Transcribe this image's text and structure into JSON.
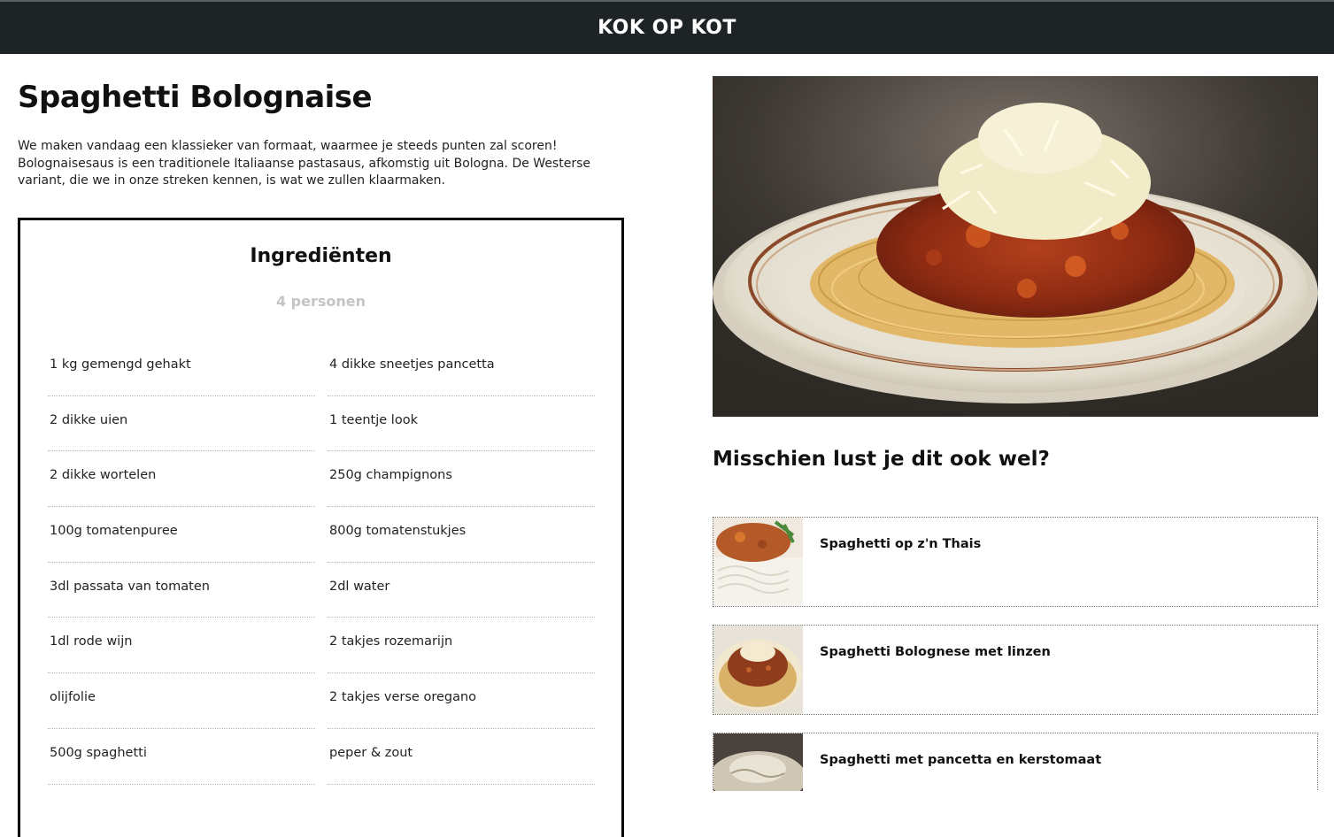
{
  "header": {
    "brand": "KOK OP KOT"
  },
  "recipe": {
    "title": "Spaghetti Bolognaise",
    "intro": "We maken vandaag een klassieker van formaat, waarmee je steeds punten zal scoren! Bolognaisesaus is een traditionele Italiaanse pastasaus, afkomstig uit Bologna. De Westerse variant, die we in onze streken kennen, is wat we zullen klaarmaken.",
    "ingredients_title": "Ingrediënten",
    "persons": "4 personen",
    "ingredients": [
      "1 kg gemengd gehakt",
      "4 dikke sneetjes pancetta",
      "2 dikke uien",
      "1 teentje look",
      "2 dikke wortelen",
      "250g champignons",
      "100g tomatenpuree",
      "800g tomatenstukjes",
      "3dl passata van tomaten",
      "2dl water",
      "1dl rode wijn",
      "2 takjes rozemarijn",
      "olijfolie",
      "2 takjes verse oregano",
      "500g spaghetti",
      "peper & zout"
    ]
  },
  "suggestions": {
    "title": "Misschien lust je dit ook wel?",
    "items": [
      {
        "label": "Spaghetti op z'n Thais"
      },
      {
        "label": "Spaghetti Bolognese met linzen"
      },
      {
        "label": "Spaghetti met pancetta en kerstomaat"
      }
    ]
  }
}
